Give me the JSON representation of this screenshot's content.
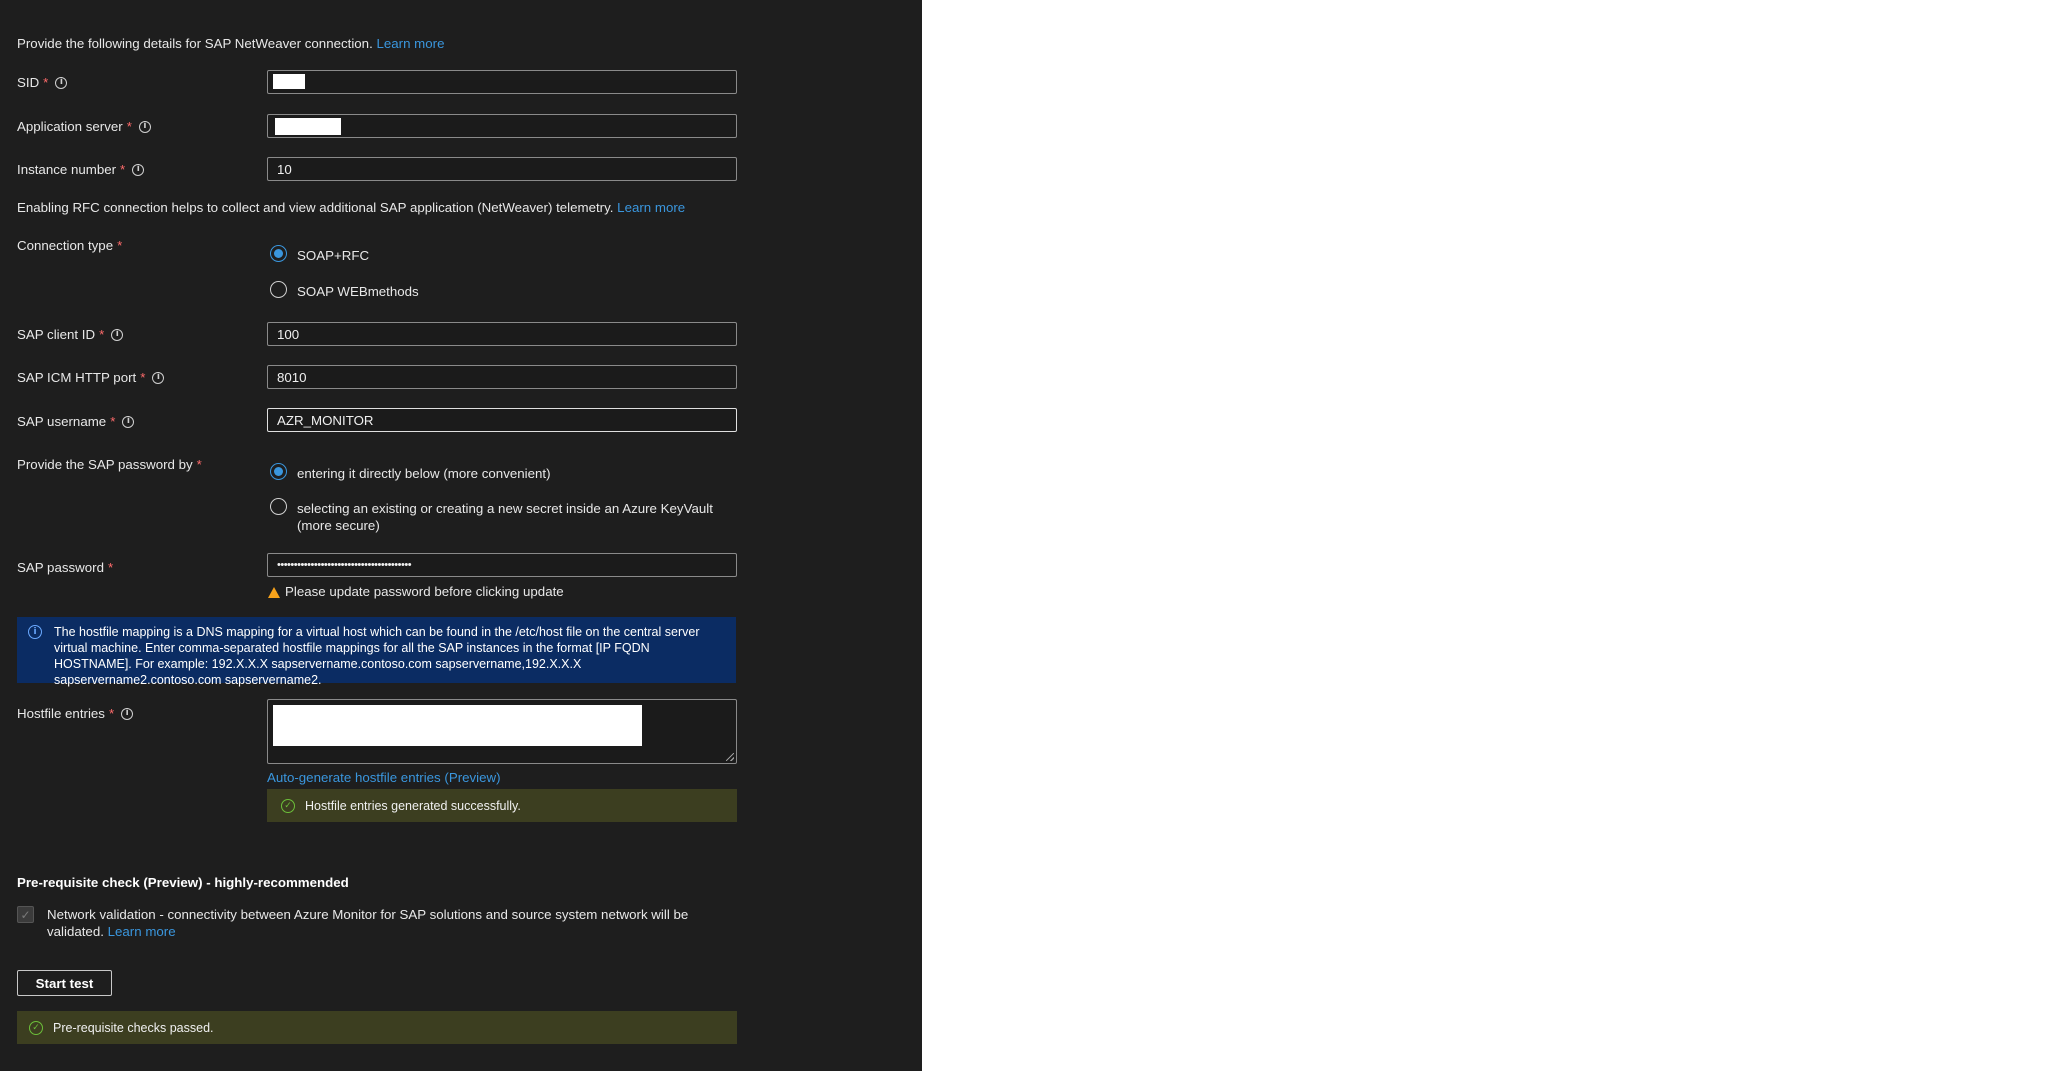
{
  "intro": {
    "text": "Provide the following details for SAP NetWeaver connection.",
    "link": "Learn more"
  },
  "fields": {
    "sid": {
      "label": "SID",
      "value": ""
    },
    "app_server": {
      "label": "Application server",
      "value": ""
    },
    "instance_number": {
      "label": "Instance number",
      "value": "10"
    },
    "client_id": {
      "label": "SAP client ID",
      "value": "100"
    },
    "icm_port": {
      "label": "SAP ICM HTTP port",
      "value": "8010"
    },
    "username": {
      "label": "SAP username",
      "value": "AZR_MONITOR"
    },
    "password": {
      "label": "SAP password",
      "value": "••••••••••••••••••••••••••••••••••••••••"
    }
  },
  "required_mark": "*",
  "rfc_note": {
    "text": "Enabling RFC connection helps to collect and view additional SAP application (NetWeaver) telemetry.",
    "link": "Learn more"
  },
  "connection_type": {
    "label": "Connection type",
    "options": [
      {
        "label": "SOAP+RFC",
        "checked": true
      },
      {
        "label": "SOAP WEBmethods",
        "checked": false
      }
    ]
  },
  "password_by": {
    "label": "Provide the SAP password by",
    "options": [
      {
        "label": "entering it directly below (more convenient)",
        "checked": true
      },
      {
        "label": "selecting an existing or creating a new secret inside an Azure KeyVault",
        "label2": "(more secure)",
        "checked": false
      }
    ]
  },
  "password_warning": "Please update password before clicking update",
  "hostfile_info": "The hostfile mapping is a DNS mapping for a virtual host which can be found in the /etc/host file on the central server virtual machine. Enter comma-separated hostfile mappings for all the SAP instances in the format [IP FQDN HOSTNAME]. For example: 192.X.X.X sapservername.contoso.com sapservername,192.X.X.X sapservername2.contoso.com sapservername2.",
  "hostfile": {
    "label": "Hostfile entries",
    "auto_generate_link": "Auto-generate hostfile entries (Preview)",
    "success_text": "Hostfile entries generated successfully."
  },
  "prereq": {
    "title": "Pre-requisite check (Preview) - highly-recommended",
    "network_line1": "Network validation - connectivity between Azure Monitor for SAP solutions and source system network will be",
    "network_line2": "validated.",
    "network_link": "Learn more",
    "start_button": "Start test",
    "passed_text": "Pre-requisite checks passed."
  },
  "colors": {
    "panel_bg": "#1e1e1e",
    "link": "#3a96dd",
    "info_bg": "#0b2c63",
    "success_bg": "#3c3e20",
    "warning": "#f7a21b"
  }
}
